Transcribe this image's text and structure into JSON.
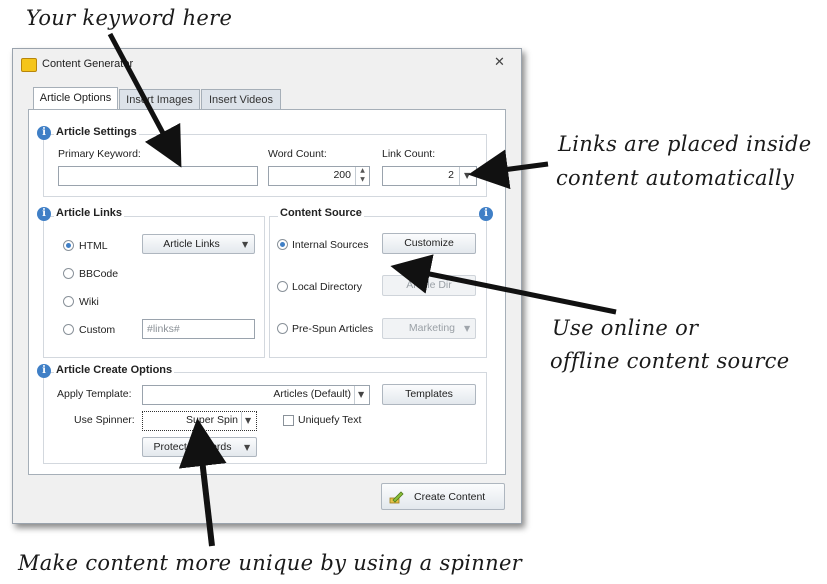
{
  "annotations": {
    "keyword": "Your keyword here",
    "links_line1": "Links are placed inside",
    "links_line2": "content automatically",
    "source_line1": "Use online or",
    "source_line2": "offline content source",
    "spinner": "Make content more unique by using a spinner"
  },
  "window": {
    "title": "Content Generator",
    "icon": "pencil-note-icon",
    "close_glyph": "✕"
  },
  "tabs": [
    "Article Options",
    "Insert Images",
    "Insert Videos"
  ],
  "article_settings": {
    "title": "Article Settings",
    "primary_keyword_label": "Primary Keyword:",
    "primary_keyword_value": "",
    "word_count_label": "Word Count:",
    "word_count_value": "200",
    "link_count_label": "Link Count:",
    "link_count_value": "2"
  },
  "article_links": {
    "title": "Article Links",
    "options": [
      "HTML",
      "BBCode",
      "Wiki",
      "Custom"
    ],
    "selected": "HTML",
    "links_button": "Article Links",
    "custom_placeholder": "#links#"
  },
  "content_source": {
    "title": "Content Source",
    "options": [
      "Internal Sources",
      "Local Directory",
      "Pre-Spun Articles"
    ],
    "selected": "Internal Sources",
    "customize_button": "Customize",
    "article_dir_button": "Article Dir",
    "marketing_select": "Marketing"
  },
  "create_options": {
    "title": "Article Create Options",
    "apply_template_label": "Apply Template:",
    "template_value": "Articles (Default)",
    "templates_button": "Templates",
    "use_spinner_label": "Use Spinner:",
    "spinner_value": "Super Spin",
    "uniquefy_label": "Uniquefy Text",
    "uniquefy_checked": false,
    "protected_words_button": "Protected Words"
  },
  "footer": {
    "create_button": "Create Content"
  },
  "colors": {
    "accent": "#3f7fc6",
    "title_icon": "#f5c51a"
  }
}
